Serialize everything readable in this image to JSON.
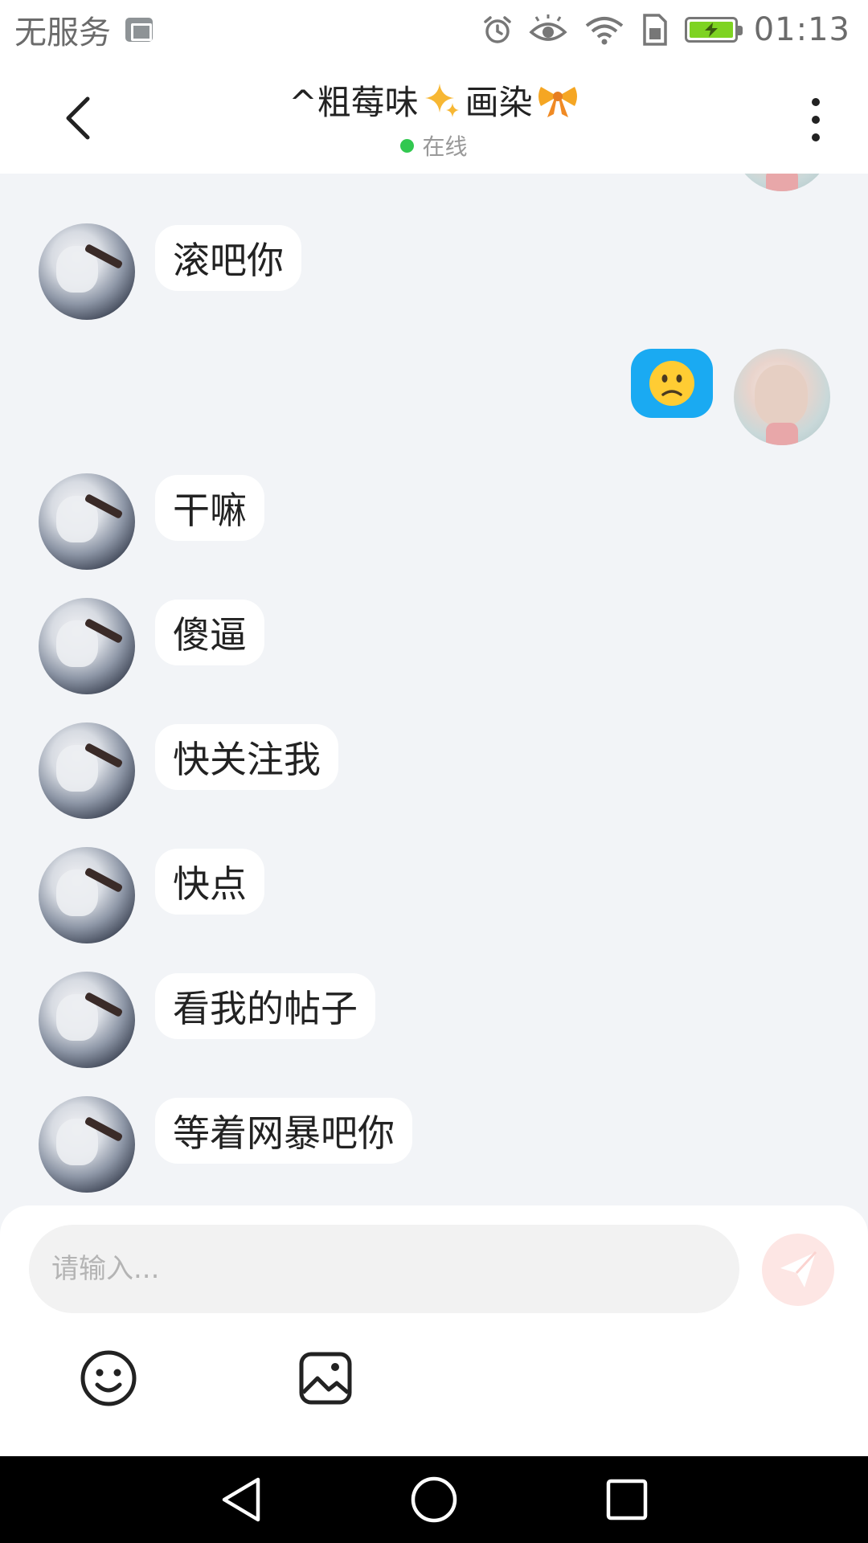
{
  "status_bar": {
    "carrier": "无服务",
    "time": "01:13",
    "icons": [
      "image-notification-icon",
      "alarm-icon",
      "eye-icon",
      "wifi-icon",
      "sim-icon",
      "battery-charging-icon"
    ],
    "battery_color": "#7ed321"
  },
  "header": {
    "back_icon": "chevron-left-icon",
    "title": "^粗莓味",
    "title_suffix": "画染",
    "title_icons": [
      "sparkle-icon",
      "bow-icon"
    ],
    "online_text": "在线",
    "online_color": "#32c850",
    "more_icon": "more-vertical-icon"
  },
  "messages": [
    {
      "from": "self",
      "type": "avatar-only",
      "partial": true
    },
    {
      "from": "other",
      "text": "滚吧你"
    },
    {
      "from": "self",
      "type": "emoji",
      "emoji": "😕",
      "bubble_color": "#1aaaf2"
    },
    {
      "from": "other",
      "text": "干嘛"
    },
    {
      "from": "other",
      "text": "傻逼"
    },
    {
      "from": "other",
      "text": "快关注我"
    },
    {
      "from": "other",
      "text": "快点"
    },
    {
      "from": "other",
      "text": "看我的帖子"
    },
    {
      "from": "other",
      "text": "等着网暴吧你"
    }
  ],
  "composer": {
    "placeholder": "请输入...",
    "value": "",
    "send_icon": "paper-plane-icon",
    "tools": [
      "smiley-icon",
      "image-icon"
    ]
  },
  "nav_bar": {
    "icons": [
      "nav-back-icon",
      "nav-home-icon",
      "nav-recents-icon"
    ]
  },
  "colors": {
    "background": "#f2f4f7",
    "bubble_other": "#ffffff",
    "bubble_self": "#1aaaf2",
    "send_button": "#fde6e4",
    "send_icon": "#ffffff"
  }
}
